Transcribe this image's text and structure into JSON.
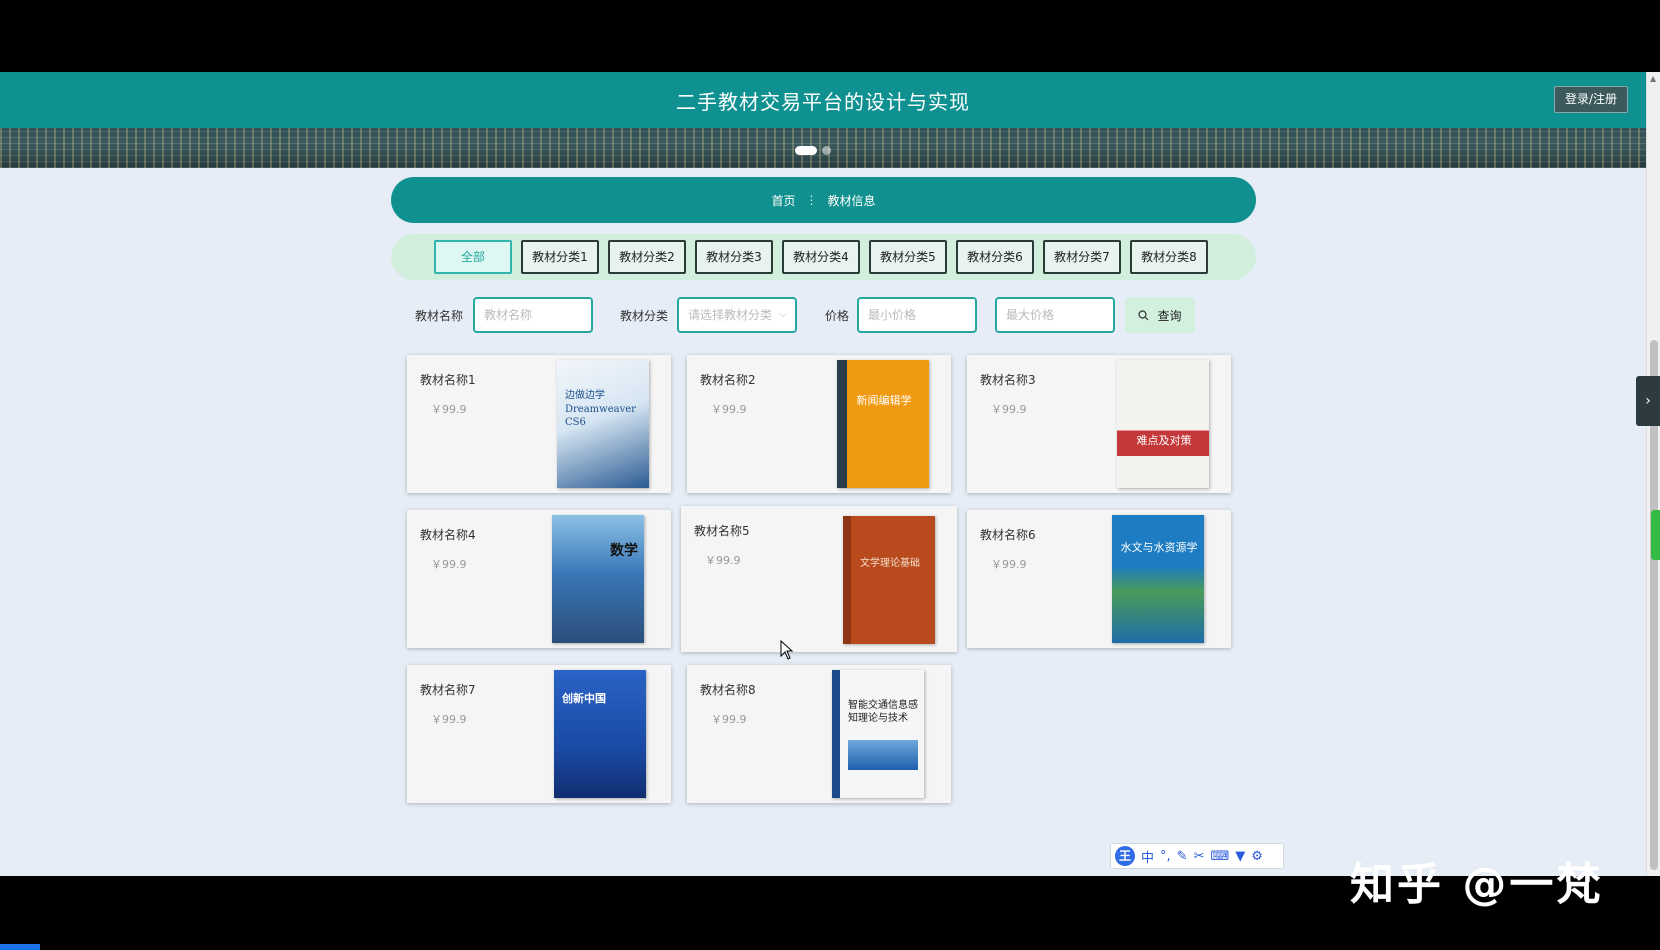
{
  "header": {
    "title": "二手教材交易平台的设计与实现",
    "login_label": "登录/注册"
  },
  "breadcrumb": {
    "home": "首页",
    "separator": "⋮",
    "current": "教材信息"
  },
  "categories": [
    "全部",
    "教材分类1",
    "教材分类2",
    "教材分类3",
    "教材分类4",
    "教材分类5",
    "教材分类6",
    "教材分类7",
    "教材分类8"
  ],
  "search": {
    "name_label": "教材名称",
    "name_placeholder": "教材名称",
    "category_label": "教材分类",
    "category_placeholder": "请选择教材分类",
    "price_label": "价格",
    "min_placeholder": "最小价格",
    "max_placeholder": "最大价格",
    "query_label": "查询"
  },
  "books": [
    {
      "name": "教材名称1",
      "price": "￥99.9",
      "cover_title": "Dreamweaver CS6",
      "cover_sub": "边做边学",
      "cover_color": "#1d4f8a"
    },
    {
      "name": "教材名称2",
      "price": "￥99.9",
      "cover_title": "新闻编辑学",
      "cover_sub": "",
      "cover_color": "#f09a12"
    },
    {
      "name": "教材名称3",
      "price": "￥99.9",
      "cover_title": "难点及对策",
      "cover_sub": "",
      "cover_color": "#c4383a"
    },
    {
      "name": "教材名称4",
      "price": "￥99.9",
      "cover_title": "数学",
      "cover_sub": "",
      "cover_color": "#3a78b8"
    },
    {
      "name": "教材名称5",
      "price": "￥99.9",
      "cover_title": "文学理论基础",
      "cover_sub": "",
      "cover_color": "#b94a1e"
    },
    {
      "name": "教材名称6",
      "price": "￥99.9",
      "cover_title": "水文与水资源学",
      "cover_sub": "",
      "cover_color": "#1e7cc2"
    },
    {
      "name": "教材名称7",
      "price": "￥99.9",
      "cover_title": "创新中国",
      "cover_sub": "",
      "cover_color": "#1a4aa6"
    },
    {
      "name": "教材名称8",
      "price": "￥99.9",
      "cover_title": "智能交通信息感知理论与技术",
      "cover_sub": "",
      "cover_color": "#e9eef2"
    }
  ],
  "ime": {
    "logo": "王",
    "mode": "中"
  },
  "watermark": "知乎 @一梵",
  "colors": {
    "primary": "#0e9190",
    "accent": "#26a8a0",
    "category_bg": "#d2efde"
  }
}
